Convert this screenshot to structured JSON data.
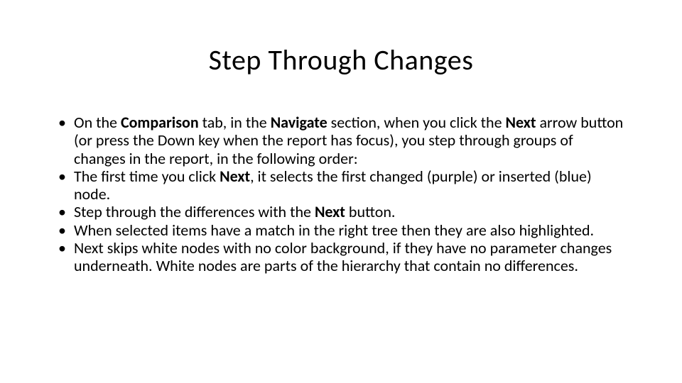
{
  "title": "Step Through Changes",
  "bullets": [
    {
      "segments": [
        {
          "text": "On the "
        },
        {
          "text": "Comparison",
          "bold": true
        },
        {
          "text": " tab, in the "
        },
        {
          "text": "Navigate",
          "bold": true
        },
        {
          "text": " section, when you click the "
        },
        {
          "text": "Next",
          "bold": true
        },
        {
          "text": " arrow button (or press the Down key when the report has focus), you step through groups of changes in the report, in the following order:"
        }
      ]
    },
    {
      "segments": [
        {
          "text": "The first time you click "
        },
        {
          "text": "Next",
          "bold": true
        },
        {
          "text": ", it selects the first changed (purple) or inserted (blue) node."
        }
      ]
    },
    {
      "segments": [
        {
          "text": "Step through the differences with the "
        },
        {
          "text": "Next",
          "bold": true
        },
        {
          "text": " button."
        }
      ]
    },
    {
      "segments": [
        {
          "text": "When selected items have a match in the right tree then they are also highlighted."
        }
      ]
    },
    {
      "segments": [
        {
          "text": "Next skips white nodes with no color background, if they have no parameter changes underneath. White nodes are parts of the hierarchy that contain no differences."
        }
      ]
    }
  ]
}
